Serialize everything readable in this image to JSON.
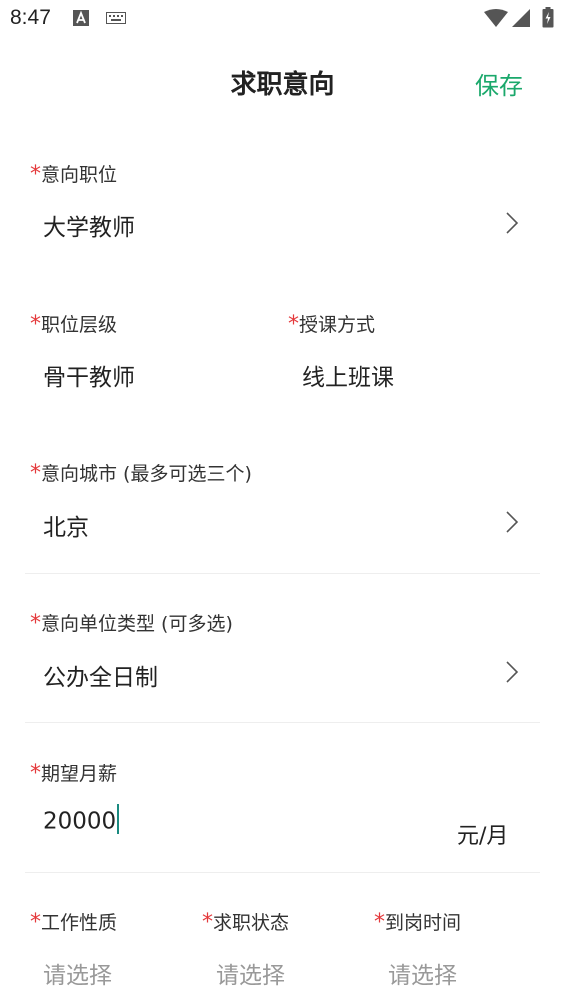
{
  "status_bar": {
    "time": "8:47"
  },
  "header": {
    "title": "求职意向",
    "save_label": "保存"
  },
  "required_mark": "*",
  "form": {
    "position": {
      "label": "意向职位",
      "value": "大学教师"
    },
    "level": {
      "label": "职位层级",
      "value": "骨干教师"
    },
    "teaching_mode": {
      "label": "授课方式",
      "value": "线上班课"
    },
    "city": {
      "label": "意向城市 (最多可选三个)",
      "value": "北京"
    },
    "unit_type": {
      "label": "意向单位类型 (可多选)",
      "value": "公办全日制"
    },
    "salary": {
      "label": "期望月薪",
      "value": "20000",
      "unit": "元/月"
    },
    "job_nature": {
      "label": "工作性质",
      "placeholder": "请选择"
    },
    "job_status": {
      "label": "求职状态",
      "placeholder": "请选择"
    },
    "arrival_time": {
      "label": "到岗时间",
      "placeholder": "请选择"
    }
  },
  "colors": {
    "accent": "#1aa86b",
    "required": "#e4393c",
    "placeholder": "#999999",
    "caret": "#1a8a80"
  }
}
